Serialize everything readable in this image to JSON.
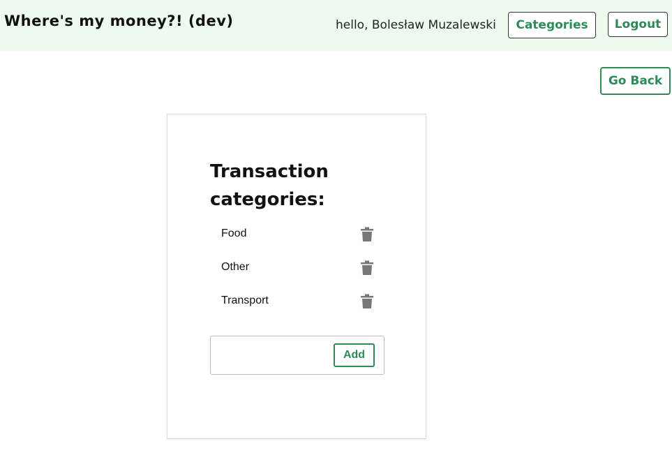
{
  "header": {
    "app_title": "Where's my money?! (dev)",
    "greeting": "hello, Bolesław Muzalewski",
    "categories_label": "Categories",
    "logout_label": "Logout"
  },
  "nav": {
    "go_back_label": "Go Back"
  },
  "card": {
    "title": "Transaction categories:",
    "categories": [
      {
        "label": "Food",
        "icon": "trash-icon"
      },
      {
        "label": "Other",
        "icon": "trash-icon"
      },
      {
        "label": "Transport",
        "icon": "trash-icon"
      }
    ],
    "new_category_value": "",
    "add_label": "Add"
  },
  "colors": {
    "header_bg": "#eef9ef",
    "accent": "#2e8b57",
    "icon": "#777777"
  }
}
